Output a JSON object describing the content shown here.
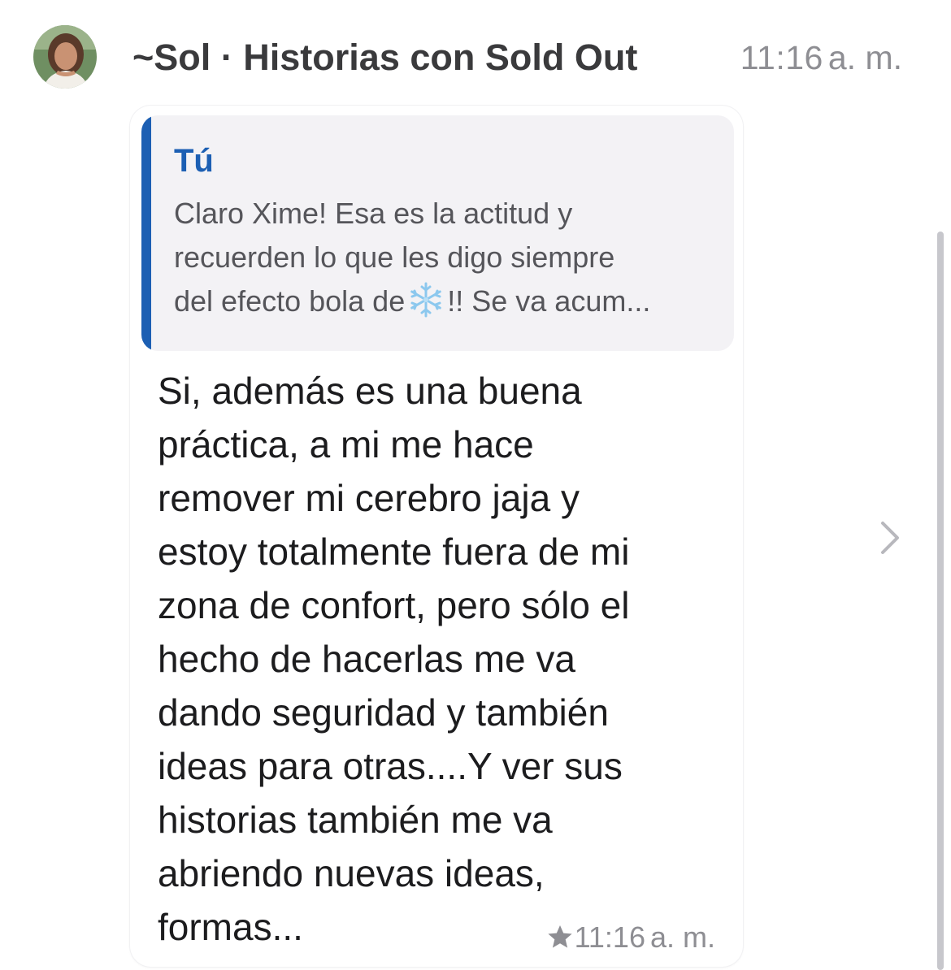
{
  "header": {
    "title": "~Sol · Historias con Sold Out",
    "time": "11:16",
    "ampm": "a. m."
  },
  "avatar": {
    "icon": "person-avatar"
  },
  "quote": {
    "author": "Tú",
    "lines": [
      "Claro Xime! Esa es la actitud y",
      "recuerden lo que les digo siempre",
      "del efecto bola de",
      "!! Se va acum..."
    ],
    "emoji": "snowflake-icon",
    "accent": "#1c5fb3"
  },
  "message": {
    "lines": [
      "Si, además es una buena",
      "práctica, a mi me hace",
      "remover mi cerebro jaja y",
      "estoy totalmente fuera de mi",
      "zona de confort, pero sólo el",
      "hecho de hacerlas me va",
      "dando seguridad y también",
      "ideas para otras....Y ver sus",
      "historias también me va",
      "abriendo nuevas ideas,",
      "formas..."
    ],
    "time": "11:16",
    "ampm": "a. m.",
    "starred": true
  }
}
